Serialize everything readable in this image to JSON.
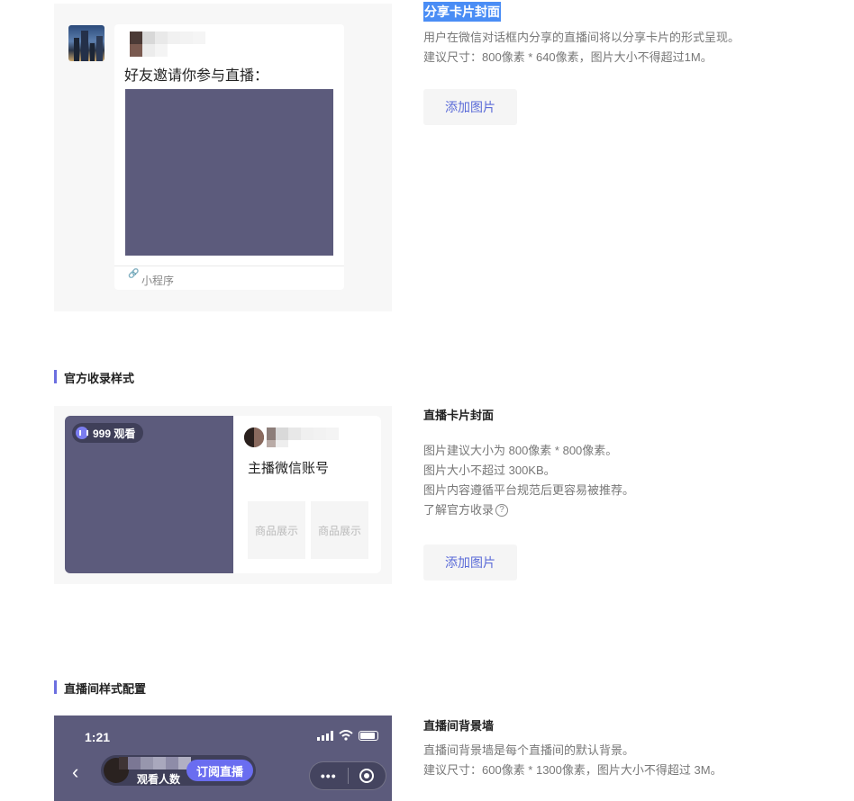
{
  "share_card": {
    "preview": {
      "invite_text": "好友邀请你参与直播：",
      "mini_program_label": "小程序",
      "cover_color": "#5c5b7c"
    },
    "title": "分享卡片封面",
    "desc_lines": [
      "用户在微信对话框内分享的直播间将以分享卡片的形式呈现。",
      "建议尺寸：800像素 * 640像素，图片大小不得超过1M。"
    ],
    "add_button": "添加图片"
  },
  "official": {
    "section_title": "官方收录样式",
    "preview": {
      "viewer_count": "999 观看",
      "anchor_name": "主播微信账号",
      "goods": [
        "商品展示",
        "商品展示"
      ]
    },
    "title": "直播卡片封面",
    "desc_lines": [
      "图片建议大小为 800像素 * 800像素。",
      "图片大小不超过 300KB。",
      "图片内容遵循平台规范后更容易被推荐。"
    ],
    "learn_link": "了解官方收录",
    "help_icon": "question-circle-icon",
    "add_button": "添加图片"
  },
  "live_room": {
    "section_title": "直播间样式配置",
    "preview": {
      "time": "1:21",
      "host_sub": "观看人数",
      "follow_button": "订阅直播",
      "menu_dots": "•••"
    },
    "title": "直播间背景墙",
    "desc_lines": [
      "直播间背景墙是每个直播间的默认背景。",
      "建议尺寸：600像素 * 1300像素，图片大小不得超过 3M。"
    ]
  },
  "colors": {
    "accent": "#6c6fe0",
    "link": "#5b6bd8",
    "highlight": "#4a8df5",
    "preview_bg": "#f7f7f7"
  }
}
